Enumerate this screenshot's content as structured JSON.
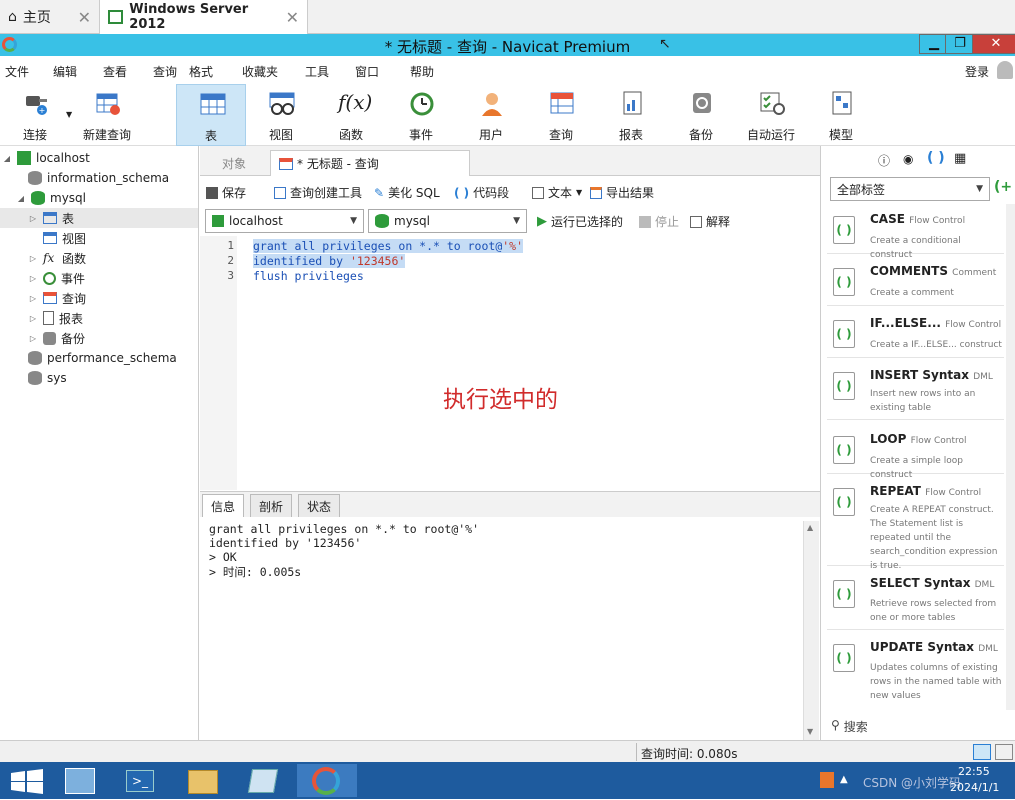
{
  "browser_tabs": [
    {
      "label": "主页",
      "active": false
    },
    {
      "label": "Windows Server 2012",
      "active": true
    }
  ],
  "window": {
    "title": "* 无标题 - 查询 - Navicat Premium",
    "min": "▁",
    "max": "❐",
    "close": "✕"
  },
  "menu": {
    "items": [
      "文件",
      "编辑",
      "查看",
      "查询",
      "格式",
      "收藏夹",
      "工具",
      "窗口",
      "帮助"
    ],
    "login": "登录"
  },
  "toolbar": [
    {
      "label": "连接",
      "icon": "plug-icon"
    },
    {
      "label": "新建查询",
      "icon": "new-query-icon"
    },
    {
      "label": "表",
      "icon": "table-icon"
    },
    {
      "label": "视图",
      "icon": "view-icon"
    },
    {
      "label": "函数",
      "icon": "function-icon"
    },
    {
      "label": "事件",
      "icon": "clock-icon"
    },
    {
      "label": "用户",
      "icon": "user-icon"
    },
    {
      "label": "查询",
      "icon": "query-icon"
    },
    {
      "label": "报表",
      "icon": "report-icon"
    },
    {
      "label": "备份",
      "icon": "backup-icon"
    },
    {
      "label": "自动运行",
      "icon": "schedule-icon"
    },
    {
      "label": "模型",
      "icon": "model-icon"
    }
  ],
  "tree": {
    "connection": "localhost",
    "databases": [
      "information_schema",
      "mysql",
      "performance_schema",
      "sys"
    ],
    "mysql_children": [
      "表",
      "视图",
      "函数",
      "事件",
      "查询",
      "报表",
      "备份"
    ]
  },
  "editor": {
    "tab_objects": "对象",
    "tab_query": "* 无标题 - 查询",
    "tools": {
      "save": "保存",
      "builder": "查询创建工具",
      "beautify": "美化 SQL",
      "snippet": "代码段",
      "text": "文本",
      "export": "导出结果"
    },
    "connection": "localhost",
    "database": "mysql",
    "run": "运行已选择的",
    "stop": "停止",
    "explain": "解释",
    "line_numbers": [
      "1",
      "2",
      "3"
    ],
    "code": {
      "l1a": "grant all privileges on *.* to root@",
      "l1b": "'%'",
      "l2a": "identified by ",
      "l2b": "'123456'",
      "l3": "flush privileges"
    },
    "annotation": "执行选中的"
  },
  "bottom": {
    "tabs": [
      "信息",
      "剖析",
      "状态"
    ],
    "messages": [
      "grant all privileges on *.* to root@'%'",
      "identified by '123456'",
      "> OK",
      "> 时间: 0.005s"
    ]
  },
  "status": {
    "query_time": "查询时间: 0.080s"
  },
  "snippets": {
    "filter": "全部标签",
    "search": "搜索",
    "items": [
      {
        "title": "CASE",
        "tag": "Flow Control",
        "desc": "Create a conditional construct"
      },
      {
        "title": "COMMENTS",
        "tag": "Comment",
        "desc": "Create a comment"
      },
      {
        "title": "IF...ELSE...",
        "tag": "Flow Control",
        "desc": "Create a IF...ELSE... construct"
      },
      {
        "title": "INSERT Syntax",
        "tag": "DML",
        "desc": "Insert new rows into an existing table"
      },
      {
        "title": "LOOP",
        "tag": "Flow Control",
        "desc": "Create a simple loop construct"
      },
      {
        "title": "REPEAT",
        "tag": "Flow Control",
        "desc": "Create A REPEAT construct. The Statement list is repeated until the search_condition expression is true."
      },
      {
        "title": "SELECT Syntax",
        "tag": "DML",
        "desc": "Retrieve rows selected from one or more tables"
      },
      {
        "title": "UPDATE Syntax",
        "tag": "DML",
        "desc": "Updates columns of existing rows in the named table with new values"
      }
    ]
  },
  "taskbar": {
    "time": "22:55",
    "date": "2024/1/1",
    "watermark": "CSDN @小刘学码"
  }
}
